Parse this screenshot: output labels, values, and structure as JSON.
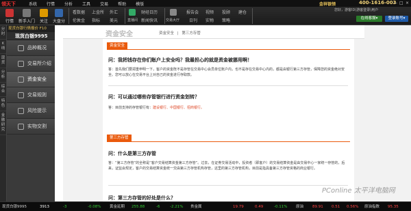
{
  "titlebar": {
    "logo": "领天下",
    "menu": [
      "系统",
      "行情",
      "分析",
      "工具",
      "交易",
      "帮助",
      "模版"
    ],
    "brand": "金祥银领",
    "hotline": "400-1616-003",
    "controls": [
      "—",
      "□",
      "×"
    ]
  },
  "toolbar": {
    "items": [
      {
        "label": "行情"
      },
      {
        "label": "新手入门"
      },
      {
        "label": "关注"
      },
      {
        "label": "大盘分析"
      }
    ],
    "grid1": [
      "看数据",
      "上金所",
      "外汇",
      "伦敦金",
      "指标",
      "美元"
    ],
    "grid2": [
      "财经日历",
      "新闻快讯"
    ],
    "badges": [
      "直播间",
      "交易大厅"
    ],
    "grid3": [
      "报告会",
      "视频",
      "投顾",
      "建仓",
      "日刊",
      "实物",
      "策略",
      ""
    ],
    "login_info": "您好，游客ID(游客登录)用户",
    "open_button": "在线客服▾",
    "account_button": "登录账号▾"
  },
  "vstrip": [
    "分时",
    "K线",
    "现货",
    "分析",
    "综合",
    "特色",
    "金融研究"
  ],
  "sidebar": {
    "head": "现货白银行情报价 F10",
    "title": "现货白银9995",
    "items": [
      {
        "label": "品种概况"
      },
      {
        "label": "交易所介绍"
      },
      {
        "label": "资金安全"
      },
      {
        "label": "交易规则"
      },
      {
        "label": "风险提示"
      },
      {
        "label": "实物交割"
      }
    ]
  },
  "header": {
    "logo": "资金安全",
    "crumb1": "资金安全",
    "crumb_sep": "|",
    "crumb2": "第三方存管"
  },
  "sections": [
    {
      "tag": "资金安全"
    },
    {
      "tag": "第三方存管"
    }
  ],
  "qa": [
    {
      "q": "问：我把钱存在你们账户上安全吗？我最担心的就是资金被挪用啊！",
      "a": "答：首先我们要郑重申明一下，客户的资金既不是存管在交易中心会员单位账户内，也不是存在交易中心内的，都是由银行第三方存管，保障您的资金绝对安全。您可以放心在交易平台上对自己的资金进行存取款。"
    },
    {
      "q": "问：可以通过哪些存管银行进行资金划转？",
      "a_prefix": "答：目前支持的存管银行有：",
      "banks": "建设银行、中国银行、招商银行。"
    },
    {
      "q": "问：什么是第三方存管",
      "a": "答：“第三方存管”的全称是“客户交易结算资金第三方存管”。过去，在证券交易活动中，投资者（即客户）的交易结算资金是由交易中心一家统一存管的，后来，证监会规定，客户的交易结算资金统一交由第三方存管机构存管，这里的第三方存管机构，目前是指具备第三方存管资格的商业银行。"
    },
    {
      "q": "问：第三方存管的好处是什么？"
    }
  ],
  "watermark": "PConline 太平洋电脑网",
  "statusbar": {
    "name": "现货白银9995",
    "price": "3913",
    "change": "-3",
    "pct": "-0.08%",
    "label2": "黄金延期",
    "v2": "255.88",
    "c2": "-6",
    "p2": "-2.21%",
    "label3": "贵金属",
    "v3": "19.79",
    "c3": "0.49",
    "p3": "-0.11%",
    "label4": "原油",
    "v4": "89.91",
    "c4": "0.51",
    "p4": "0.56%",
    "label5": "原油指数",
    "v5": "95.35"
  }
}
